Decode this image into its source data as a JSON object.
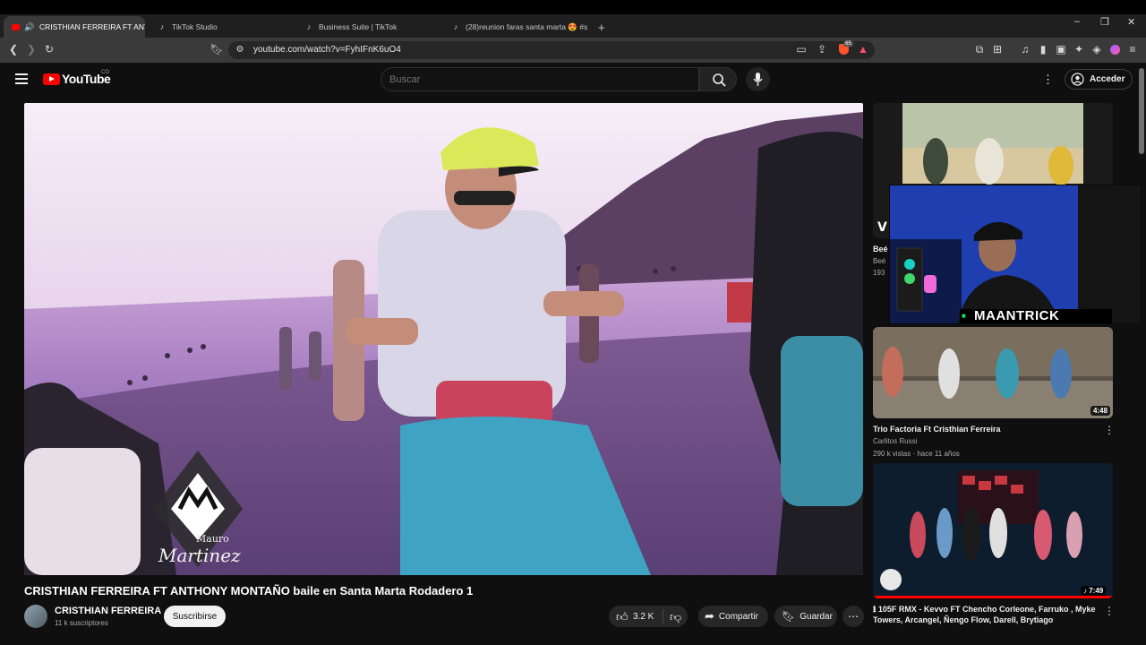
{
  "browser": {
    "tabs": [
      {
        "label": "CRISTHIAN FERREIRA FT ANT",
        "active": true
      },
      {
        "label": "TikTok Studio",
        "active": false
      },
      {
        "label": "Business Suite | TikTok",
        "active": false
      },
      {
        "label": "(28)reunion faras santa marta 😍 #sa",
        "active": false
      }
    ],
    "new_tab": "+",
    "url": "youtube.com/watch?v=FyhIFnK6uO4",
    "badge": "65"
  },
  "youtube": {
    "wordmark": "YouTube",
    "country": "CO",
    "search_placeholder": "Buscar",
    "signin": "Acceder"
  },
  "video": {
    "title": "CRISTHIAN FERREIRA FT ANTHONY MONTAÑO baile en Santa Marta Rodadero 1",
    "channel": "CRISTHIAN FERREIRA",
    "subscribers": "11 k suscriptores",
    "subscribe": "Suscribirse",
    "likes": "3.2 K",
    "share": "Compartir",
    "save": "Guardar",
    "watermark_line1": "Mauro",
    "watermark_line2": "Martinez"
  },
  "webcam": {
    "name": "MAANTRICK"
  },
  "sidebar": [
    {
      "title": "Beé",
      "channel": "Beé",
      "meta": "193"
    },
    {
      "title": "Trio Factoria Ft Cristhian Ferreira",
      "channel": "Carlitos Russi",
      "meta": "290 k vistas · hace 11 años",
      "duration": "4:48"
    },
    {
      "title": "ℹ 105F RMX - Kevvo FT Chencho Corleone, Farruko , Myke Towers, Arcangel, Ñengo Flow, Darell, Brytiago",
      "duration": "♪ 7:49"
    }
  ],
  "colors": {
    "accent": "#ff0000",
    "bg": "#0f0f0f"
  }
}
